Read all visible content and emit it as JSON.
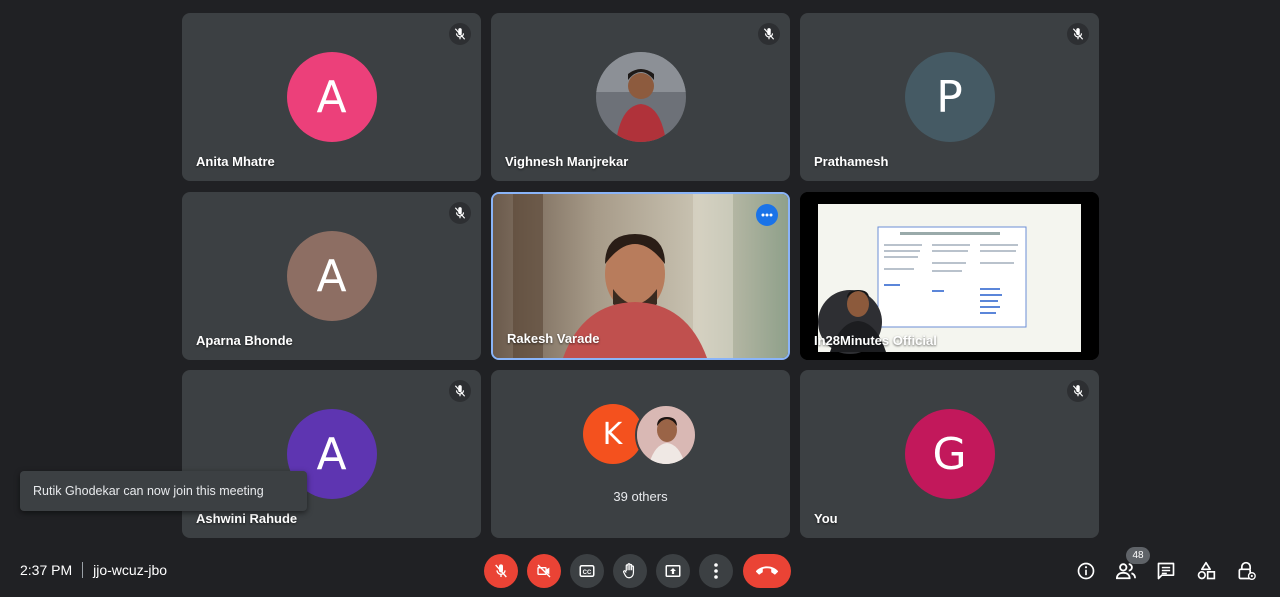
{
  "participants": [
    {
      "name": "Anita Mhatre",
      "initial": "A",
      "avatar_color": "#ec407a",
      "muted": true
    },
    {
      "name": "Vighnesh Manjrekar",
      "initial": "",
      "avatar_color": "#7b8088",
      "muted": true
    },
    {
      "name": "Prathamesh",
      "initial": "P",
      "avatar_color": "#455a64",
      "muted": true
    },
    {
      "name": "Aparna Bhonde",
      "initial": "A",
      "avatar_color": "#8d6e63",
      "muted": true
    },
    {
      "name": "Rakesh Varade",
      "initial": "",
      "avatar_color": "#b0a58f",
      "muted": false
    },
    {
      "name": "In28Minutes Official",
      "initial": "",
      "avatar_color": "#111111",
      "muted": false
    },
    {
      "name": "Ashwini Rahude",
      "initial": "A",
      "avatar_color": "#5e35b1",
      "muted": true
    },
    {
      "name": "",
      "initial": "K",
      "avatar_color": "#f4511e",
      "muted": false
    },
    {
      "name": "You",
      "initial": "G",
      "avatar_color": "#c2185b",
      "muted": true
    }
  ],
  "others_label": "39 others",
  "toast": "Rutik Ghodekar can now join this meeting",
  "meeting": {
    "time": "2:37 PM",
    "code": "jjo-wcuz-jbo"
  },
  "people_count": "48",
  "icons": {
    "mic": "mic-off-icon",
    "camera": "videocam-off-icon",
    "captions": "closed-caption-icon",
    "hand": "raise-hand-icon",
    "present": "present-screen-icon",
    "more": "more-vert-icon",
    "end": "call-end-icon",
    "info": "info-icon",
    "people": "people-icon",
    "chat": "chat-icon",
    "activities": "activities-icon",
    "host": "host-controls-icon"
  },
  "colors": {
    "background": "#202124",
    "tile": "#3c4043",
    "danger": "#ea4335",
    "active_border": "#8ab4f8"
  }
}
